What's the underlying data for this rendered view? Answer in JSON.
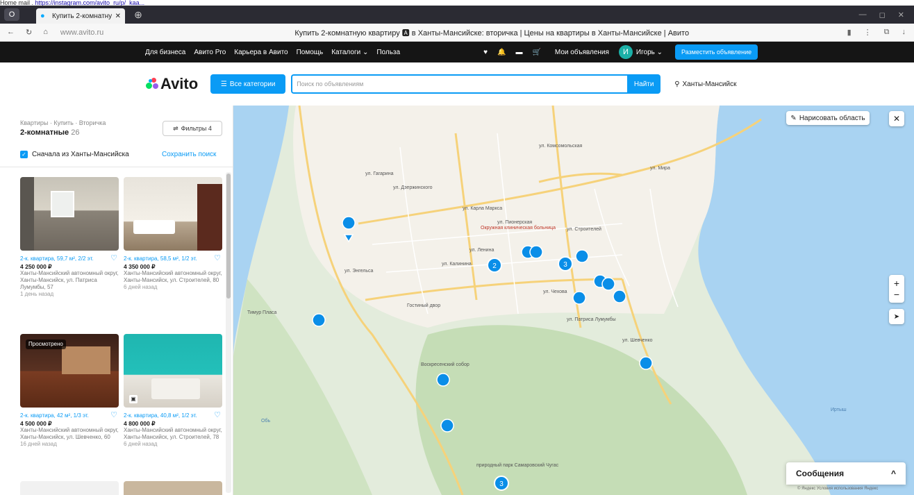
{
  "top_note": {
    "prefix": "Home mail . ",
    "link": "https://instagram.com/avito_ru/p/_kaa... "
  },
  "browser": {
    "tab_title": "Купить 2-комнатную к",
    "url": "www.avito.ru",
    "page_title": "Купить 2-комнатную квартиру 🅰 в Ханты-Мансийске: вторичка | Цены на квартиры в Ханты-Мансийске | Авито",
    "nav_back": "←",
    "nav_reload": "↻",
    "nav_home": "⌂"
  },
  "site_header": {
    "links": [
      "Для бизнеса",
      "Авито Pro",
      "Карьера в Авито",
      "Помощь",
      "Каталоги ⌄",
      "Польза"
    ],
    "my_ads": "Мои объявления",
    "avatar_letter": "И",
    "user_name": "Игорь ⌄",
    "post_button": "Разместить объявление"
  },
  "search": {
    "logo_text": "Avito",
    "categories_button": "Все категории",
    "placeholder": "Поиск по объявлениям",
    "find_button": "Найти",
    "location": "Ханты-Мансийск"
  },
  "sidebar": {
    "breadcrumbs": "Квартиры · Купить · Вторичка",
    "heading": "2-комнатные",
    "count": "26",
    "filters_button": "Фильтры 4",
    "checkbox_label": "Сначала из Ханты-Мансийска",
    "save_search": "Сохранить поиск",
    "listings": [
      {
        "title": "2-к. квартира, 59,7 м², 2/2 эт.",
        "price": "4 250 000 ₽",
        "address": "Ханты-Мансийский автономный округ, Ханты-Мансийск, ул. Патриса Лумумбы, 57",
        "ago": "1 день назад",
        "viewed": ""
      },
      {
        "title": "2-к. квартира, 58,5 м², 1/2 эт.",
        "price": "4 350 000 ₽",
        "address": "Ханты-Мансийский автономный округ, Ханты-Мансийск, ул. Строителей, 80",
        "ago": "6 дней назад",
        "viewed": ""
      },
      {
        "title": "2-к. квартира, 42 м², 1/3 эт.",
        "price": "4 500 000 ₽",
        "address": "Ханты-Мансийский автономный округ, Ханты-Мансийск, ул. Шевченко, 60",
        "ago": "16 дней назад",
        "viewed": "Просмотрено"
      },
      {
        "title": "2-к. квартира, 40,8 м², 1/2 эт.",
        "price": "4 800 000 ₽",
        "address": "Ханты-Мансийский автономный округ, Ханты-Мансийск, ул. Строителей, 78",
        "ago": "6 дней назад",
        "viewed": ""
      }
    ]
  },
  "map": {
    "draw_area": "Нарисовать область",
    "close": "✕",
    "zoom_in": "+",
    "zoom_out": "−",
    "locate": "➤",
    "messages": "Сообщения",
    "messages_toggle": "^",
    "copyright": "© Яндекс  Условия использования  Яндекс",
    "labels": [
      "ул. Мира",
      "ул. Чехова",
      "ул. Ленина",
      "ул. Карла Маркса",
      "ул. Пионерская",
      "ул. Дзержинского",
      "ул. Гагарина",
      "ул. Энгельса",
      "ул. Калинина",
      "ул. Комсомольская",
      "ул. Строителей",
      "ул. Шевченко",
      "ул. Патриса Лумумбы",
      "Гостиный двор",
      "Воскресенский собор",
      "природный парк Самаровский Чугас",
      "Окружная клиническая больница",
      "Тимур Пласа",
      "Обь",
      "Иртыш"
    ],
    "cluster_counts": [
      "2",
      "3",
      "3"
    ]
  },
  "colors": {
    "accent": "#0a9bf5",
    "header_bg": "#151515",
    "map_bg": "#e3ecdc",
    "pin": "#0a8ee8"
  }
}
